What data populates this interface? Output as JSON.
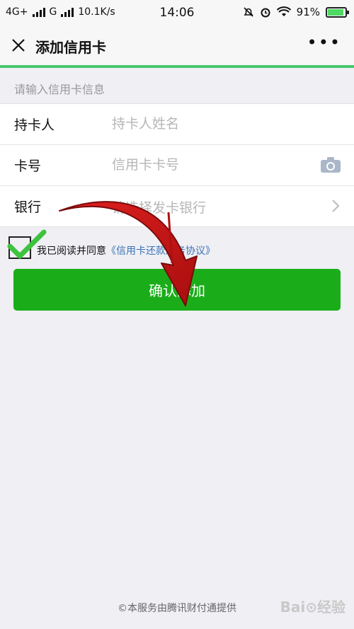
{
  "status_bar": {
    "network": "4G+",
    "carrier2": "G",
    "speed": "10.1K/s",
    "time": "14:06",
    "battery": "91%"
  },
  "header": {
    "title": "添加信用卡",
    "close_icon": "close-icon",
    "more_icon": "more-icon"
  },
  "progress": 1.0,
  "section_hint": "请输入信用卡信息",
  "form": {
    "cardholder": {
      "label": "持卡人",
      "placeholder": "持卡人姓名",
      "value": ""
    },
    "card_number": {
      "label": "卡号",
      "placeholder": "信用卡卡号",
      "value": ""
    },
    "bank": {
      "label": "银行",
      "placeholder": "请选择发卡银行"
    }
  },
  "agreement": {
    "checked": true,
    "prefix": "我已阅读并同意",
    "link": "《信用卡还款服务协议》"
  },
  "confirm_button": "确认添加",
  "footer": "©本服务由腾讯财付通提供",
  "watermark": "Bai⊙经验",
  "colors": {
    "accent_green": "#1aad19",
    "progress_green": "#47c66b",
    "link_blue": "#3b73b5",
    "annotation_red": "#d01818"
  }
}
